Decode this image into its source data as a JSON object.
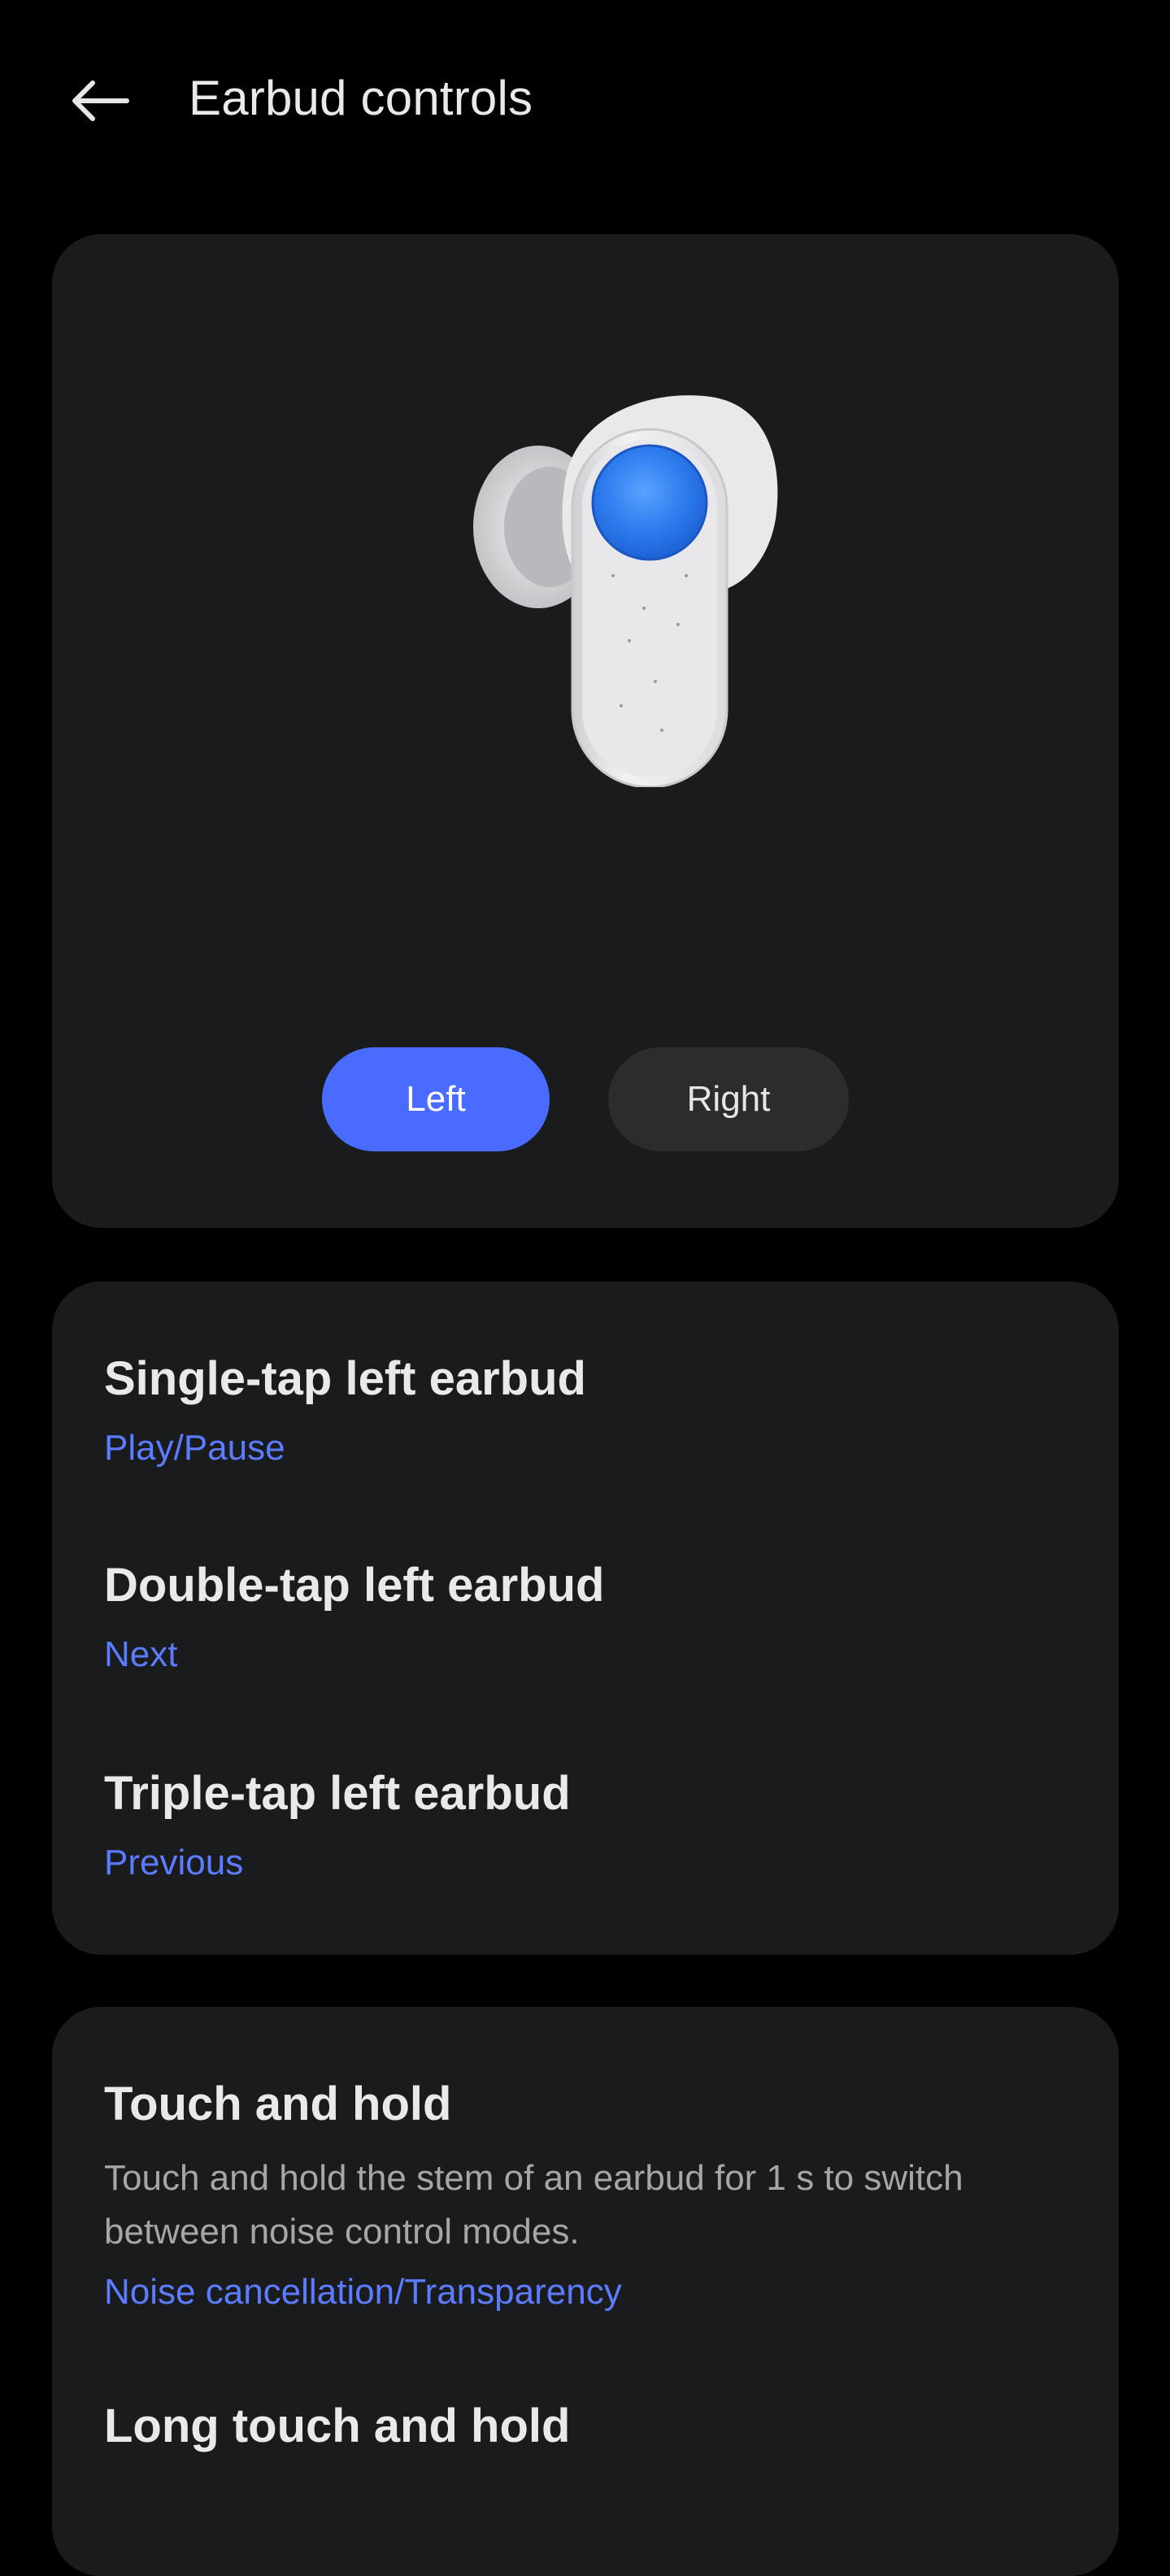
{
  "header": {
    "title": "Earbud controls",
    "back_icon": "arrow-left-icon"
  },
  "hero": {
    "earbud_image": "white-earbud-with-blue-touch-pad",
    "segments": [
      {
        "label": "Left",
        "selected": true
      },
      {
        "label": "Right",
        "selected": false
      }
    ]
  },
  "tap_controls": [
    {
      "title": "Single-tap left earbud",
      "value": "Play/Pause"
    },
    {
      "title": "Double-tap left earbud",
      "value": "Next"
    },
    {
      "title": "Triple-tap left earbud",
      "value": "Previous"
    }
  ],
  "hold_controls": {
    "touch_and_hold": {
      "title": "Touch and hold",
      "description": "Touch and hold the stem of an earbud for 1 s to switch between noise control modes.",
      "value": "Noise cancellation/Transparency"
    },
    "long_touch_and_hold": {
      "title": "Long touch and hold"
    }
  },
  "colors": {
    "background": "#000000",
    "card": "#1A1B1C",
    "accent": "#4A6BFF",
    "accent_text": "#5C7CFF",
    "segment_inactive": "#2B2C2E"
  }
}
